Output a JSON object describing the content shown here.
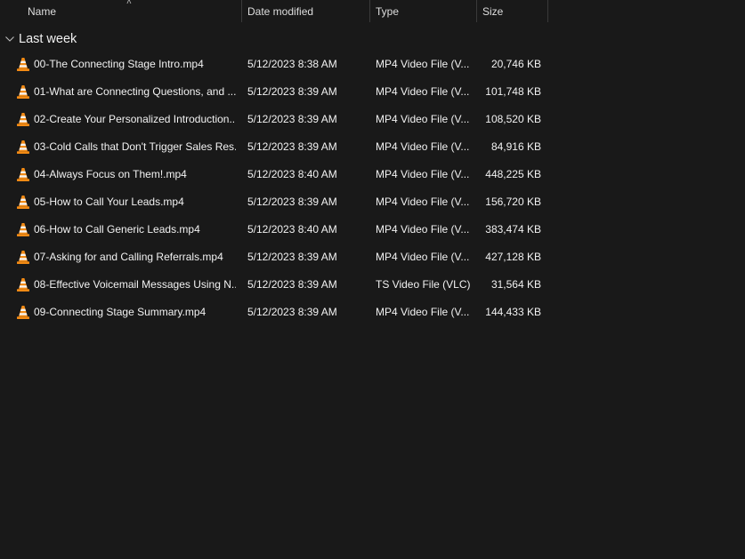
{
  "columns": {
    "name": "Name",
    "date": "Date modified",
    "type": "Type",
    "size": "Size"
  },
  "group": {
    "title": "Last week"
  },
  "files": [
    {
      "name": "00-The Connecting Stage Intro.mp4",
      "date": "5/12/2023 8:38 AM",
      "type": "MP4 Video File (V...",
      "size": "20,746 KB"
    },
    {
      "name": "01-What are Connecting Questions, and ...",
      "date": "5/12/2023 8:39 AM",
      "type": "MP4 Video File (V...",
      "size": "101,748 KB"
    },
    {
      "name": "02-Create Your Personalized Introduction...",
      "date": "5/12/2023 8:39 AM",
      "type": "MP4 Video File (V...",
      "size": "108,520 KB"
    },
    {
      "name": "03-Cold Calls that Don't Trigger Sales Res...",
      "date": "5/12/2023 8:39 AM",
      "type": "MP4 Video File (V...",
      "size": "84,916 KB"
    },
    {
      "name": "04-Always Focus on Them!.mp4",
      "date": "5/12/2023 8:40 AM",
      "type": "MP4 Video File (V...",
      "size": "448,225 KB"
    },
    {
      "name": "05-How to Call Your Leads.mp4",
      "date": "5/12/2023 8:39 AM",
      "type": "MP4 Video File (V...",
      "size": "156,720 KB"
    },
    {
      "name": "06-How to Call Generic Leads.mp4",
      "date": "5/12/2023 8:40 AM",
      "type": "MP4 Video File (V...",
      "size": "383,474 KB"
    },
    {
      "name": "07-Asking for and Calling Referrals.mp4",
      "date": "5/12/2023 8:39 AM",
      "type": "MP4 Video File (V...",
      "size": "427,128 KB"
    },
    {
      "name": "08-Effective Voicemail Messages Using N...",
      "date": "5/12/2023 8:39 AM",
      "type": "TS Video File (VLC)",
      "size": "31,564 KB"
    },
    {
      "name": "09-Connecting Stage Summary.mp4",
      "date": "5/12/2023 8:39 AM",
      "type": "MP4 Video File (V...",
      "size": "144,433 KB"
    }
  ],
  "icons": {
    "file_icon": "vlc-cone-icon",
    "group_toggle": "chevron-down-icon",
    "sort_indicator": "sort-ascending-icon"
  },
  "colors": {
    "background": "#191919",
    "vlc_orange": "#f28a14",
    "vlc_stripe": "#f5f5f5"
  }
}
